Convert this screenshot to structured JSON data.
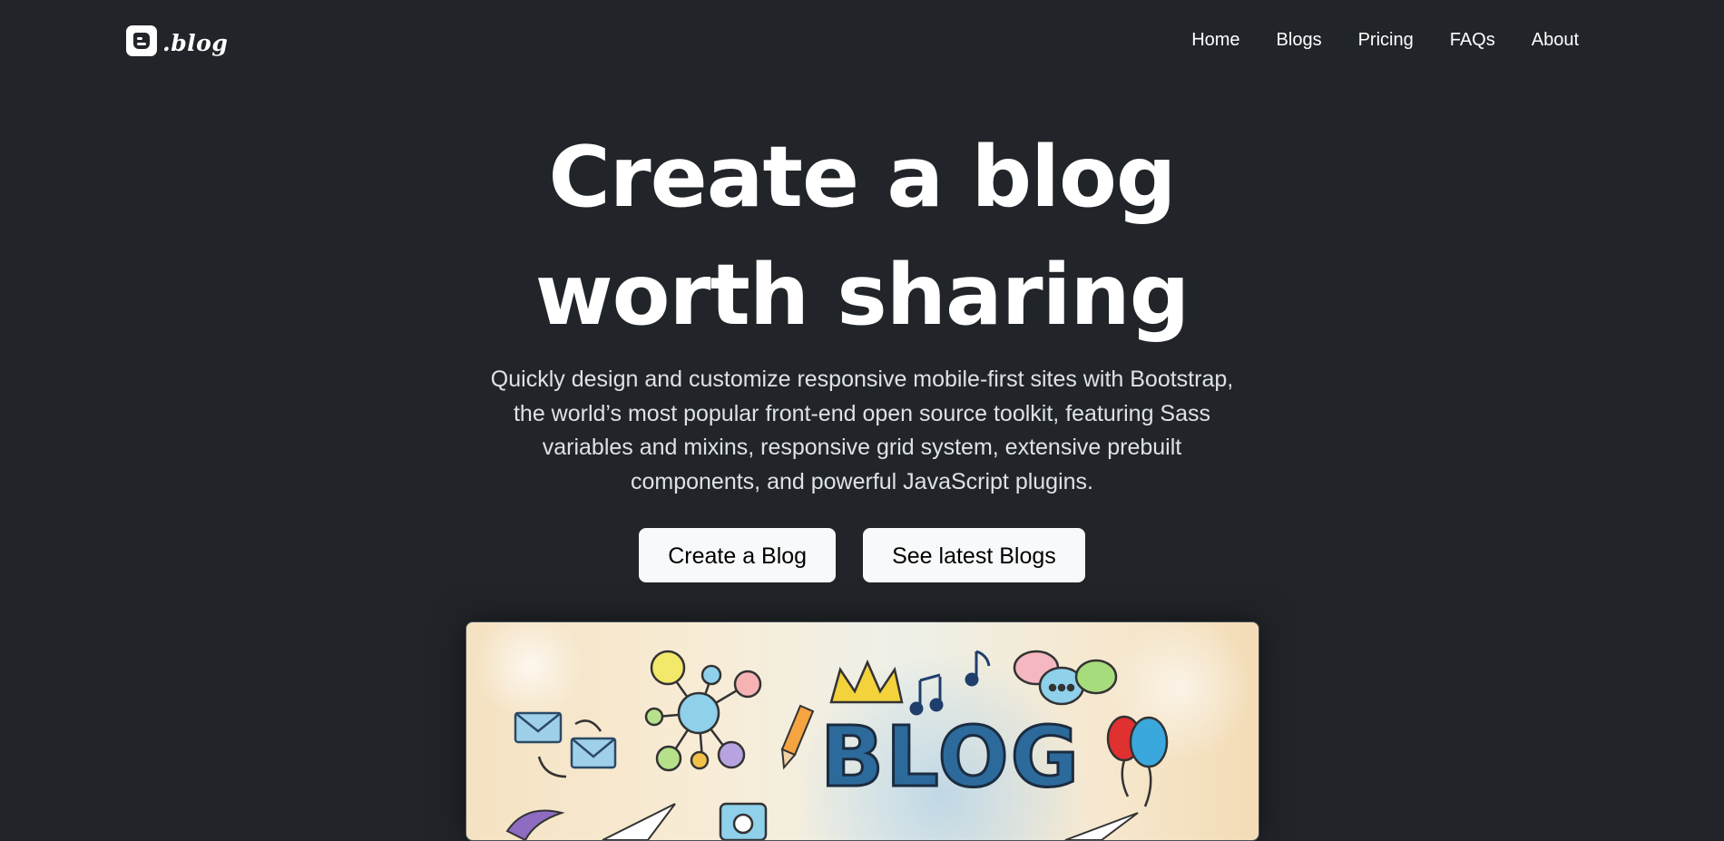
{
  "brand": {
    "name": ".blog",
    "icon": "blogger-icon"
  },
  "nav": {
    "items": [
      {
        "label": "Home"
      },
      {
        "label": "Blogs"
      },
      {
        "label": "Pricing"
      },
      {
        "label": "FAQs"
      },
      {
        "label": "About"
      }
    ]
  },
  "hero": {
    "title_line1": "Create a blog",
    "title_line2": "worth sharing",
    "lead": "Quickly design and customize responsive mobile-first sites with Bootstrap, the world’s most popular front-end open source toolkit, featuring Sass variables and mixins, responsive grid system, extensive prebuilt components, and powerful JavaScript plugins.",
    "primary_button": "Create a Blog",
    "secondary_button": "See latest Blogs",
    "image_text": "BLOG"
  },
  "colors": {
    "background": "#212529",
    "text": "#ffffff",
    "lead_text": "#dee2e6",
    "button_bg": "#f8f9fa",
    "button_text": "#000000"
  }
}
